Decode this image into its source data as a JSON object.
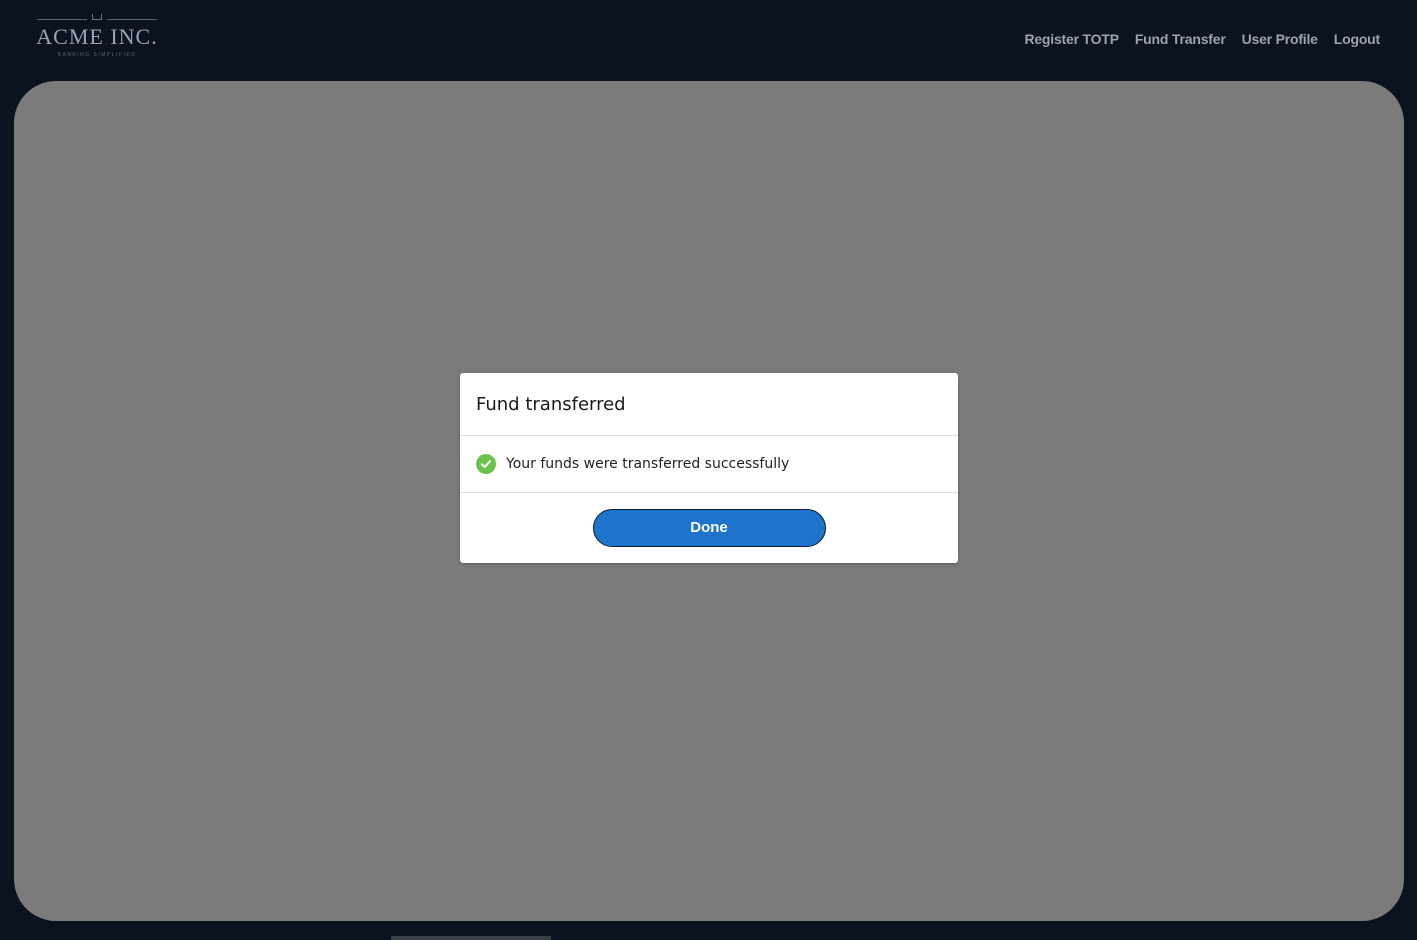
{
  "brand": {
    "name": "ACME INC.",
    "tagline": "BANKING SIMPLIFIED"
  },
  "nav": {
    "items": [
      {
        "label": "Register TOTP"
      },
      {
        "label": "Fund Transfer"
      },
      {
        "label": "User Profile"
      },
      {
        "label": "Logout"
      }
    ]
  },
  "modal": {
    "title": "Fund transferred",
    "message": "Your funds were transferred successfully",
    "status_icon": "check-circle-icon",
    "done_label": "Done"
  },
  "colors": {
    "background": "#0b1220",
    "overlay": "#7b7b7b",
    "accent": "#1f73cc",
    "success": "#6cc24a"
  }
}
